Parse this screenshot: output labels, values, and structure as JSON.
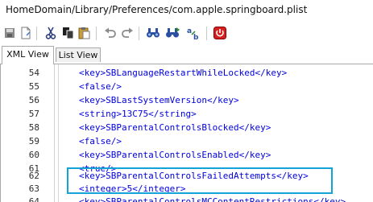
{
  "window": {
    "title": "HomeDomain/Library/Preferences/com.apple.springboard.plist"
  },
  "toolbar": {
    "buttons": [
      {
        "name": "save-icon"
      },
      {
        "name": "new-document-icon"
      },
      {
        "name": "cut-icon"
      },
      {
        "name": "copy-icon"
      },
      {
        "name": "paste-icon"
      },
      {
        "name": "undo-icon"
      },
      {
        "name": "redo-icon"
      },
      {
        "name": "find-icon"
      },
      {
        "name": "find-next-icon"
      },
      {
        "name": "replace-icon"
      },
      {
        "name": "exit-icon"
      }
    ]
  },
  "tabs": [
    {
      "label": "XML View",
      "active": true
    },
    {
      "label": "List View",
      "active": false
    }
  ],
  "lines": [
    {
      "number": "54",
      "code": "<key>SBLanguageRestartWhileLocked</key>"
    },
    {
      "number": "55",
      "code": "<false/>"
    },
    {
      "number": "56",
      "code": "<key>SBLastSystemVersion</key>"
    },
    {
      "number": "57",
      "code": "<string>13C75</string>"
    },
    {
      "number": "58",
      "code": "<key>SBParentalControlsBlocked</key>"
    },
    {
      "number": "59",
      "code": "<false/>"
    },
    {
      "number": "60",
      "code": "<key>SBParentalControlsEnabled</key>"
    },
    {
      "number": "61",
      "code": "<true/>"
    },
    {
      "number": "62",
      "code": "<key>SBParentalControlsFailedAttempts</key>"
    },
    {
      "number": "63",
      "code": "<integer>5</integer>"
    },
    {
      "number": "64",
      "code": "<key>SBParentalControlsMCContentRestrictions</key>"
    }
  ],
  "colors": {
    "tag": "#0000e0",
    "text": "#202020",
    "highlight_border": "#13a3d8"
  }
}
